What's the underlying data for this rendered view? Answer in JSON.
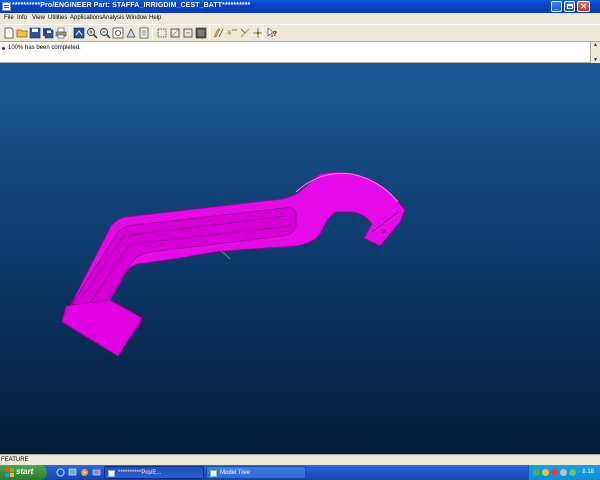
{
  "window": {
    "title": "**********Pro/ENGINEER Part: STAFFA_IRRIGDIM_CEST_BATT**********",
    "controls": [
      "minimize-icon",
      "maximize-icon",
      "close-icon"
    ]
  },
  "menu": {
    "items": [
      {
        "label": "File"
      },
      {
        "label": "Info"
      },
      {
        "label": "View"
      },
      {
        "label": "Utilities"
      },
      {
        "label": "Applications"
      },
      {
        "label": "Analysis"
      },
      {
        "label": "Window"
      },
      {
        "label": "Help"
      }
    ]
  },
  "toolbar": {
    "buttons": [
      "new-icon",
      "open-icon",
      "save-icon",
      "save-as-icon",
      "print-icon",
      "repaint-icon",
      "zoom-in-icon",
      "zoom-out-icon",
      "refit-icon",
      "orient-icon",
      "saved-views-icon",
      "datum-planes-icon",
      "datum-axes-icon",
      "datum-points-icon",
      "coord-sys-icon",
      "layers-icon",
      "spin-center-icon",
      "context-help-icon"
    ]
  },
  "message": {
    "text": "100% has been completed."
  },
  "viewport": {
    "part_color": "#e60ae6",
    "bg_top": "#1d5a96",
    "bg_bottom": "#031c3a"
  },
  "status": {
    "text": "FEATURE"
  },
  "taskbar": {
    "start_label": "start",
    "tasks": [
      {
        "label": "**********Pro/E..."
      },
      {
        "label": "Model Tree"
      }
    ],
    "clock": "8.18"
  }
}
